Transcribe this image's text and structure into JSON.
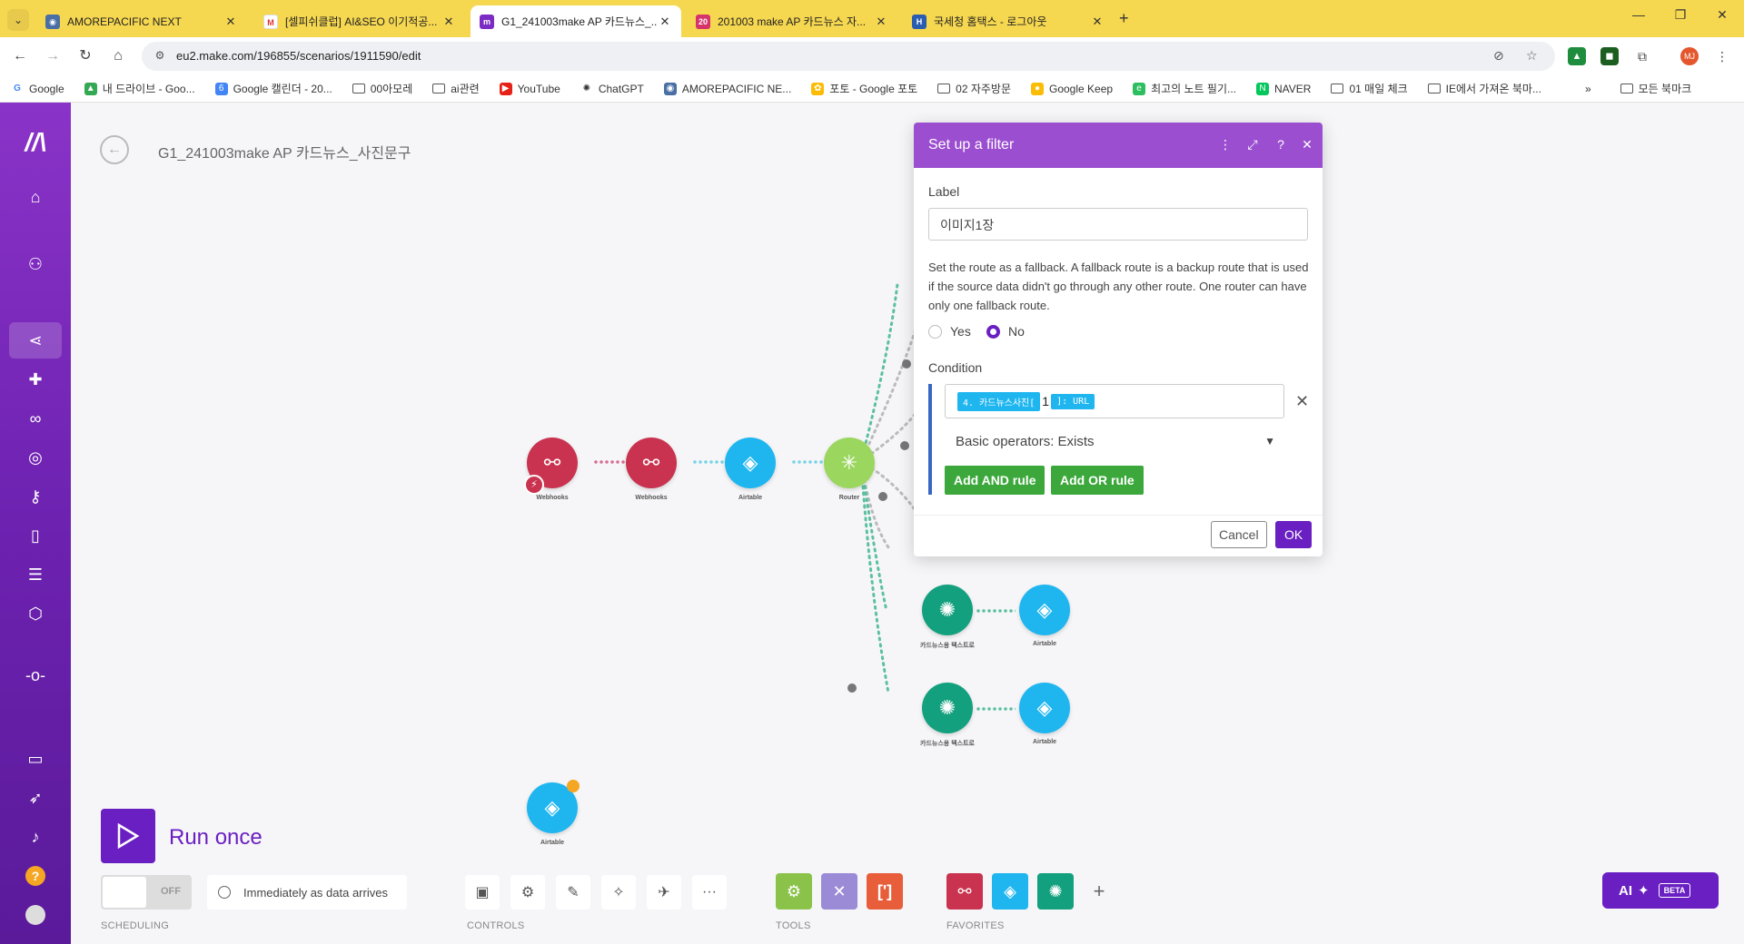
{
  "browser": {
    "tabs": [
      {
        "title": "AMOREPACIFIC NEXT",
        "active": false
      },
      {
        "title": "[셀피쉬클럽] AI&SEO 이기적공...",
        "active": false
      },
      {
        "title": "G1_241003make AP 카드뉴스_...",
        "active": true
      },
      {
        "title": "201003 make AP 카드뉴스 자...",
        "active": false
      },
      {
        "title": "국세청 홈택스 - 로그아웃",
        "active": false
      }
    ],
    "url": "eu2.make.com/196855/scenarios/1911590/edit",
    "profile_initials": "MJ",
    "bookmarks": [
      {
        "label": "Google",
        "type": "site"
      },
      {
        "label": "내 드라이브 - Goo...",
        "type": "site"
      },
      {
        "label": "Google 캘린더 - 20...",
        "type": "site"
      },
      {
        "label": "00아모레",
        "type": "folder"
      },
      {
        "label": "ai관련",
        "type": "folder"
      },
      {
        "label": "YouTube",
        "type": "site"
      },
      {
        "label": "ChatGPT",
        "type": "site"
      },
      {
        "label": "AMOREPACIFIC NE...",
        "type": "site"
      },
      {
        "label": "포토 - Google 포토",
        "type": "site"
      },
      {
        "label": "02 자주방문",
        "type": "folder"
      },
      {
        "label": "Google Keep",
        "type": "site"
      },
      {
        "label": "최고의 노트 필기...",
        "type": "site"
      },
      {
        "label": "NAVER",
        "type": "site"
      },
      {
        "label": "01 매일 체크",
        "type": "folder"
      },
      {
        "label": "IE에서 가져온 북마...",
        "type": "folder"
      }
    ],
    "all_bookmarks_label": "모든 북마크"
  },
  "scenario": {
    "title": "G1_241003make AP 카드뉴스_사진문구"
  },
  "nodes": {
    "webhooks1": {
      "label": "Webhooks"
    },
    "webhooks2": {
      "label": "Webhooks"
    },
    "airtable1": {
      "label": "Airtable"
    },
    "router": {
      "label": "Router"
    },
    "openai1": {
      "label": "카드뉴스용 텍스트로"
    },
    "airtable2": {
      "label": "Airtable"
    },
    "openai2": {
      "label": "카드뉴스용 텍스트로"
    },
    "airtable3": {
      "label": "Airtable"
    },
    "airtable_lone": {
      "label": "Airtable"
    }
  },
  "toolbar": {
    "run_label": "Run once",
    "toggle_state": "OFF",
    "schedule_text": "Immediately as data arrives",
    "scheduling_label": "SCHEDULING",
    "controls_label": "CONTROLS",
    "tools_label": "TOOLS",
    "favorites_label": "FAVORITES",
    "ai_label": "AI",
    "beta_label": "BETA"
  },
  "filter_dialog": {
    "title": "Set up a filter",
    "label_heading": "Label",
    "label_value": "이미지1장",
    "fallback_help": "Set the route as a fallback. A fallback route is a backup route that is used if the source data didn't go through any other route. One router can have only one fallback route.",
    "fallback_options": [
      {
        "label": "Yes",
        "selected": false
      },
      {
        "label": "No",
        "selected": true
      }
    ],
    "condition_heading": "Condition",
    "condition_pill_1": "4. 카드뉴스사진[",
    "condition_text": "1",
    "condition_pill_2": "]: URL",
    "operator": "Basic operators: Exists",
    "add_and_label": "Add AND rule",
    "add_or_label": "Add OR rule",
    "cancel_label": "Cancel",
    "ok_label": "OK"
  },
  "colors": {
    "make_purple": "#6a1fc2",
    "dialog_header": "#9b4fd0",
    "webhooks": "#c9334f",
    "airtable": "#1fb6f0",
    "router": "#9bd65f",
    "openai": "#13a07e",
    "green_button": "#3ca83c",
    "tabbar": "#f6d750"
  }
}
